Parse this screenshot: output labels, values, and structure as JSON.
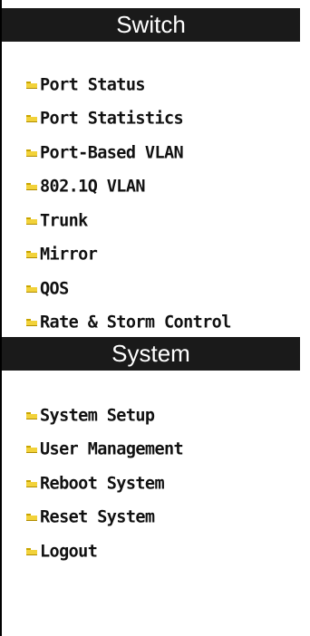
{
  "sections": [
    {
      "title": "Switch",
      "items": [
        {
          "label": "Port Status"
        },
        {
          "label": "Port Statistics"
        },
        {
          "label": "Port-Based VLAN"
        },
        {
          "label": "802.1Q VLAN"
        },
        {
          "label": "Trunk"
        },
        {
          "label": "Mirror"
        },
        {
          "label": "QOS"
        },
        {
          "label": "Rate & Storm Control"
        }
      ]
    },
    {
      "title": "System",
      "items": [
        {
          "label": "System Setup"
        },
        {
          "label": "User Management"
        },
        {
          "label": "Reboot System"
        },
        {
          "label": "Reset System"
        },
        {
          "label": "Logout"
        }
      ]
    }
  ],
  "colors": {
    "header_bg": "#1a1a1a",
    "header_text": "#ffffff",
    "item_text": "#111111",
    "folder_icon": "#f2d23a"
  }
}
